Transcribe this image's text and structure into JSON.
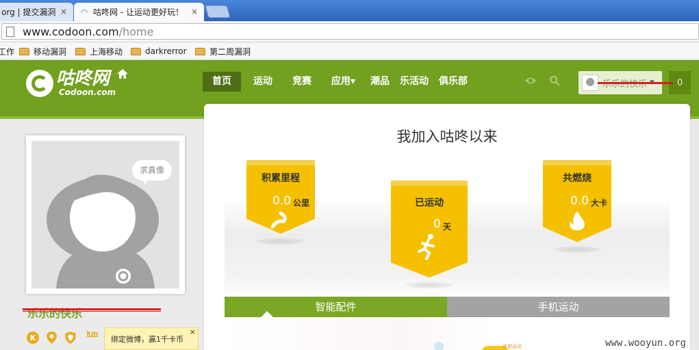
{
  "browser": {
    "tabs": [
      {
        "label": "org | 提交漏洞",
        "active": false
      },
      {
        "label": "咕咚网 - 让运动更好玩！",
        "active": true
      }
    ],
    "tab_close": "×",
    "url_host": "www.codoon.com",
    "url_path": "/home",
    "bookmarks": [
      "工作",
      "移动漏洞",
      "上海移动",
      "darkrerror",
      "第二周漏洞"
    ]
  },
  "site": {
    "logo_cn": "咕咚网",
    "logo_en": "Codoon.com",
    "nav": [
      "首页",
      "运动",
      "竞赛",
      "应用▾",
      "潮品",
      "乐活动",
      "俱乐部"
    ],
    "user_name": "乐乐的快乐",
    "user_caret": "▼",
    "notify_count": "0",
    "brand_color": "#72a01f",
    "accent_color": "#f4c000"
  },
  "profile": {
    "bubble_text": "求真像",
    "name": "乐乐的快乐",
    "badges": [
      "K",
      "location-pin-icon",
      "shield-icon",
      "km"
    ],
    "weibo_tip": "绑定微博，赢1千卡币",
    "weibo_close": "×"
  },
  "stats": {
    "title": "我加入咕咚以来",
    "cards": [
      {
        "label": "积累里程",
        "value": "0.0",
        "unit": "公里",
        "icon": "road-icon"
      },
      {
        "label": "已运动",
        "value": "0",
        "unit": "天",
        "icon": "runner-icon"
      },
      {
        "label": "共燃烧",
        "value": "0.0",
        "unit": "大卡",
        "icon": "flame-icon"
      }
    ]
  },
  "tabs2": [
    "智能配件",
    "手机运动"
  ],
  "panel": {
    "mini_text": "谁是运动"
  },
  "watermark": "www.wooyun.org"
}
